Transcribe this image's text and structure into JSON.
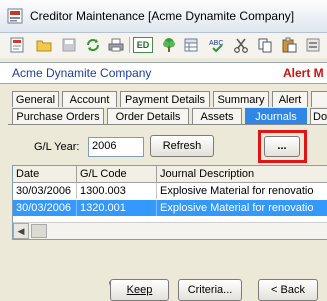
{
  "window": {
    "title": "Creditor Maintenance  [Acme Dynamite Company]"
  },
  "toolbar": {
    "icons": [
      "record-icon",
      "open-folder-icon",
      "save-icon",
      "refresh-icon",
      "print-icon",
      "ed-icon",
      "tree-icon",
      "grid-icon",
      "spellcheck-icon",
      "cut-icon",
      "copy-icon",
      "paste-icon",
      "more-icon"
    ],
    "ed_label": "ED"
  },
  "header": {
    "company": "Acme Dynamite Company",
    "alert": "Alert M"
  },
  "tabs": {
    "row1": [
      "General",
      "Account",
      "Payment Details",
      "Summary",
      "Alert",
      ""
    ],
    "row2": [
      "Purchase Orders",
      "Order Details",
      "Assets",
      "Journals",
      "Do"
    ],
    "active": "Journals"
  },
  "journals": {
    "gl_year_label": "G/L Year:",
    "gl_year_value": "2006",
    "refresh_label": "Refresh",
    "ellipsis_label": "...",
    "columns": [
      "Date",
      "G/L Code",
      "Journal Description"
    ],
    "rows": [
      {
        "date": "30/03/2006",
        "code": "1300.003",
        "desc": "Explosive Material for renovatio"
      },
      {
        "date": "30/03/2006",
        "code": "1320.001",
        "desc": "Explosive Material for renovatio"
      }
    ]
  },
  "buttons": {
    "keep": "Keep",
    "criteria": "Criteria...",
    "back": "< Back"
  },
  "colors": {
    "accent": "#2f86e6",
    "alert": "#d01010",
    "highlight": "#e01515",
    "selection": "#3399ff"
  }
}
